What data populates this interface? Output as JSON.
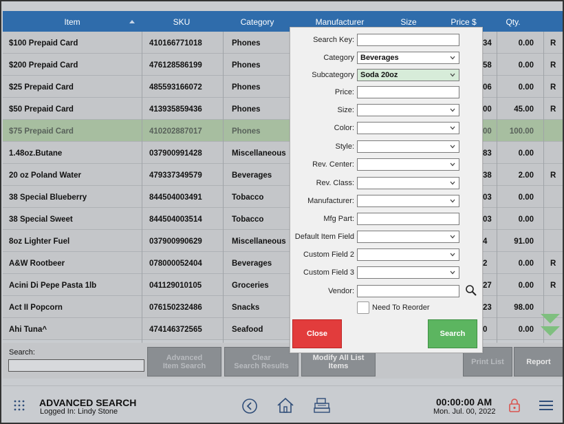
{
  "table": {
    "headers": {
      "item": "Item",
      "sku": "SKU",
      "category": "Category",
      "manufacturer": "Manufacturer",
      "size": "Size",
      "price": "Price $",
      "qty": "Qty."
    },
    "rows": [
      {
        "item": "$100 Prepaid Card",
        "sku": "410166771018",
        "category": "Phones",
        "price": "34",
        "qty": "0.00",
        "flag": "R"
      },
      {
        "item": "$200 Prepaid Card",
        "sku": "476128586199",
        "category": "Phones",
        "price": "58",
        "qty": "0.00",
        "flag": "R"
      },
      {
        "item": "$25 Prepaid Card",
        "sku": "485593166072",
        "category": "Phones",
        "price": "06",
        "qty": "0.00",
        "flag": "R"
      },
      {
        "item": "$50 Prepaid Card",
        "sku": "413935859436",
        "category": "Phones",
        "price": "00",
        "qty": "45.00",
        "flag": "R"
      },
      {
        "item": "$75 Prepaid Card",
        "sku": "410202887017",
        "category": "Phones",
        "price": "00",
        "qty": "100.00",
        "flag": ""
      },
      {
        "item": "1.48oz.Butane",
        "sku": "037900991428",
        "category": "Miscellaneous",
        "price": "83",
        "qty": "0.00",
        "flag": ""
      },
      {
        "item": "20 oz Poland Water",
        "sku": "479337349579",
        "category": "Beverages",
        "price": "38",
        "qty": "2.00",
        "flag": "R"
      },
      {
        "item": "38 Special Blueberry",
        "sku": "844504003491",
        "category": "Tobacco",
        "price": "03",
        "qty": "0.00",
        "flag": ""
      },
      {
        "item": "38 Special Sweet",
        "sku": "844504003514",
        "category": "Tobacco",
        "price": "03",
        "qty": "0.00",
        "flag": ""
      },
      {
        "item": "8oz Lighter Fuel",
        "sku": "037900990629",
        "category": "Miscellaneous",
        "price": "4",
        "qty": "91.00",
        "flag": ""
      },
      {
        "item": "A&W Rootbeer",
        "sku": "078000052404",
        "category": "Beverages",
        "price": "2",
        "qty": "0.00",
        "flag": "R"
      },
      {
        "item": "Acini Di Pepe Pasta 1lb",
        "sku": "041129010105",
        "category": "Groceries",
        "price": "27",
        "qty": "0.00",
        "flag": "R"
      },
      {
        "item": "Act II Popcorn",
        "sku": "076150232486",
        "category": "Snacks",
        "price": "23",
        "qty": "98.00",
        "flag": ""
      },
      {
        "item": "Ahi Tuna^",
        "sku": "474146372565",
        "category": "Seafood",
        "price": "0",
        "qty": "0.00",
        "flag": ""
      }
    ],
    "selected_row_index": 4
  },
  "actionbar": {
    "search_label": "Search:",
    "search_value": "",
    "advanced_line1": "Advanced",
    "advanced_line2": "Item Search",
    "clear_line1": "Clear",
    "clear_line2": "Search Results",
    "modify_line1": "Modify All List",
    "modify_line2": "Items",
    "print_list": "Print List",
    "report": "Report"
  },
  "footer": {
    "title": "ADVANCED SEARCH",
    "logged_in": "Logged In:  Lindy Stone",
    "time": "00:00:00 AM",
    "date": "Mon. Jul. 00, 2022"
  },
  "modal": {
    "fields": [
      {
        "label": "Search Key:",
        "value": "",
        "type": "text"
      },
      {
        "label": "Category",
        "value": "Beverages",
        "type": "select"
      },
      {
        "label": "Subcategory",
        "value": "Soda 20oz",
        "type": "select",
        "highlight": true
      },
      {
        "label": "Price:",
        "value": "",
        "type": "text"
      },
      {
        "label": "Size:",
        "value": "",
        "type": "select"
      },
      {
        "label": "Color:",
        "value": "",
        "type": "select"
      },
      {
        "label": "Style:",
        "value": "",
        "type": "select"
      },
      {
        "label": "Rev. Center:",
        "value": "",
        "type": "select"
      },
      {
        "label": "Rev. Class:",
        "value": "",
        "type": "select"
      },
      {
        "label": "Manufacturer:",
        "value": "",
        "type": "select"
      },
      {
        "label": "Mfg Part:",
        "value": "",
        "type": "text"
      },
      {
        "label": "Default Item Field",
        "value": "",
        "type": "select"
      },
      {
        "label": "Custom Field 2",
        "value": "",
        "type": "select"
      },
      {
        "label": "Custom Field 3",
        "value": "",
        "type": "select"
      },
      {
        "label": "Vendor:",
        "value": "",
        "type": "text"
      }
    ],
    "need_reorder_label": "Need To Reorder",
    "need_reorder_checked": false,
    "close_label": "Close",
    "search_label": "Search"
  },
  "colors": {
    "header_blue": "#2f6cab",
    "selected_row": "#a7bea0",
    "close_red": "#e23c3c",
    "search_green": "#5cb560",
    "subcategory_highlight": "#d7ecd9"
  },
  "icons": {
    "menu": "grid-dots-icon",
    "back": "back-circle-icon",
    "home": "home-icon",
    "register": "register-icon",
    "lock": "lock-icon",
    "hamburger": "hamburger-icon",
    "scroll_down": "double-chevron-down-icon",
    "vendor_search": "search-icon"
  }
}
